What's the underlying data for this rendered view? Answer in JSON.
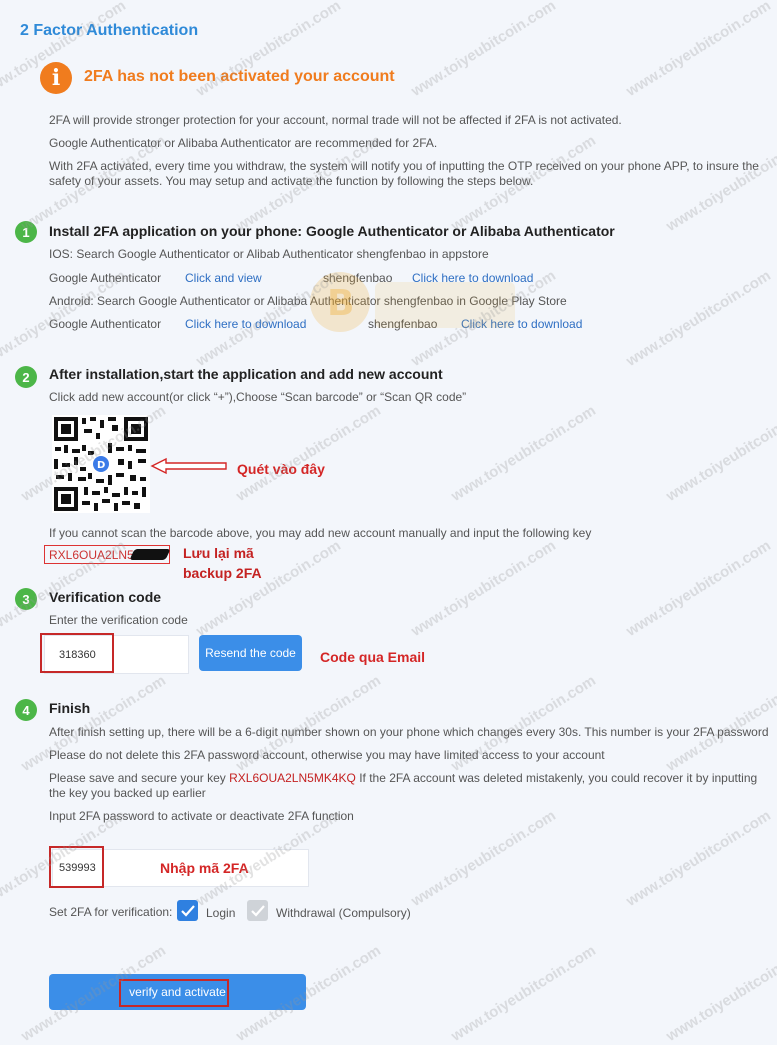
{
  "page_title": "2 Factor Authentication",
  "warning": {
    "icon": "info-icon",
    "icon_glyph": "i",
    "title": "2FA has not been activated your account",
    "lines": [
      "2FA will provide stronger protection for your account, normal trade will not be affected if 2FA is not activated.",
      "Google Authenticator or Alibaba Authenticator are recommended for 2FA.",
      "With 2FA activated, every time you withdraw, the system will notify you of inputting the OTP received on your phone APP, to insure the safety of your assets. You may setup and activate the function by following the steps below."
    ]
  },
  "steps": [
    {
      "number": "1",
      "title": "Install 2FA application on your phone: Google Authenticator or Alibaba Authenticator",
      "ios_text": "IOS: Search Google Authenticator or Alibab Authenticator shengfenbao in appstore",
      "ios_row": {
        "app1": "Google Authenticator",
        "link1": "Click and view",
        "app2": "shengfenbao",
        "link2": "Click here to download"
      },
      "android_text": "Android: Search Google Authenticator or Alibaba Authenticator shengfenbao in Google Play Store",
      "android_row": {
        "app1": "Google Authenticator",
        "link1": "Click here to download",
        "app2": "shengfenbao",
        "link2": "Click here to download"
      }
    },
    {
      "number": "2",
      "title": "After installation,start the application and add new account",
      "instruction": "Click add new account(or click “+”),Choose “Scan barcode” or “Scan QR code”",
      "manual_text": "If you cannot scan the barcode above, you may add new account manually and input the following key",
      "key": "RXL6OUA2LN5M"
    },
    {
      "number": "3",
      "title": "Verification code",
      "label": "Enter the verification code",
      "code_value": "318360",
      "resend_label": "Resend the code"
    },
    {
      "number": "4",
      "title": "Finish",
      "line1": "After finish setting up, there will be a 6-digit number shown on your phone which changes every 30s. This number is your 2FA password",
      "line2": "Please do not delete this 2FA password account, otherwise you may have limited access to your account",
      "line3_pre": "Please save and secure your key",
      "line3_key": "RXL6OUA2LN5MK4KQ",
      "line3_post": "If the 2FA account was deleted mistakenly, you could recover it by inputting the key you backed up earlier",
      "line4": "Input 2FA password to activate or deactivate 2FA function",
      "password_value": "539993",
      "verification_label": "Set 2FA for verification:",
      "login_label": "Login",
      "withdrawal_label": "Withdrawal (Compulsory)",
      "submit_label": "verify and activate"
    }
  ],
  "annotations": {
    "scan_here": "Quét vào đây",
    "save_backup_line1": "Lưu lại mã",
    "save_backup_line2": "backup 2FA",
    "code_email": "Code qua Email",
    "enter_2fa": "Nhập mã 2FA"
  },
  "watermark_text": "www.toiyeubitcoin.com",
  "colors": {
    "title_blue": "#2f8ad8",
    "warning_orange": "#f07c1e",
    "step_green": "#4cb648",
    "link_blue": "#2f6fc3",
    "button_blue": "#3b8ee8",
    "annotation_red": "#d42626"
  }
}
